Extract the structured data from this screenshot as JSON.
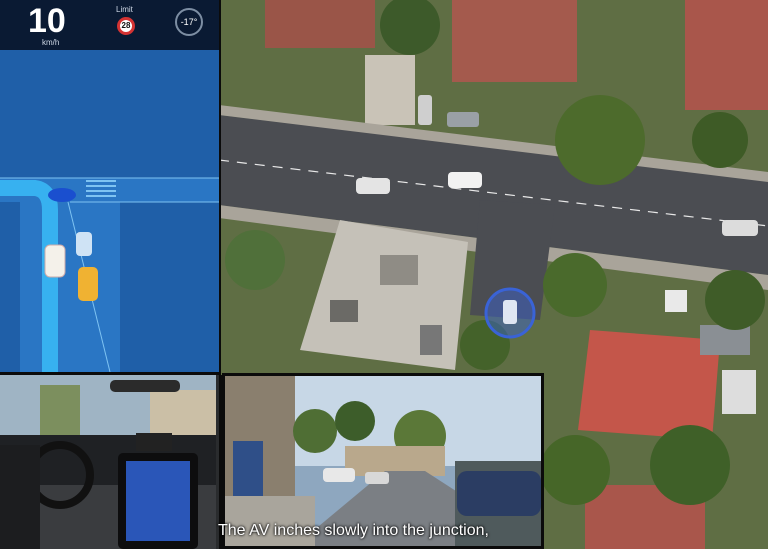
{
  "hud": {
    "speed": "10",
    "speed_unit": "km/h",
    "limit_label": "Limit",
    "limit_value": "28",
    "temperature": "-17°",
    "icons": [
      "speed-limit-sign-icon",
      "temperature-gauge-icon",
      "car-icon"
    ]
  },
  "aerial": {
    "title": "",
    "highlight_color": "#3a63d6"
  },
  "cameras": {
    "cabin_view": "",
    "front_view": ""
  },
  "caption": "The AV inches slowly into the junction,",
  "colors": {
    "hud_blue": "#1f5fa8",
    "route_cyan": "#3cc6ff",
    "car_yellow": "#f0b232"
  }
}
